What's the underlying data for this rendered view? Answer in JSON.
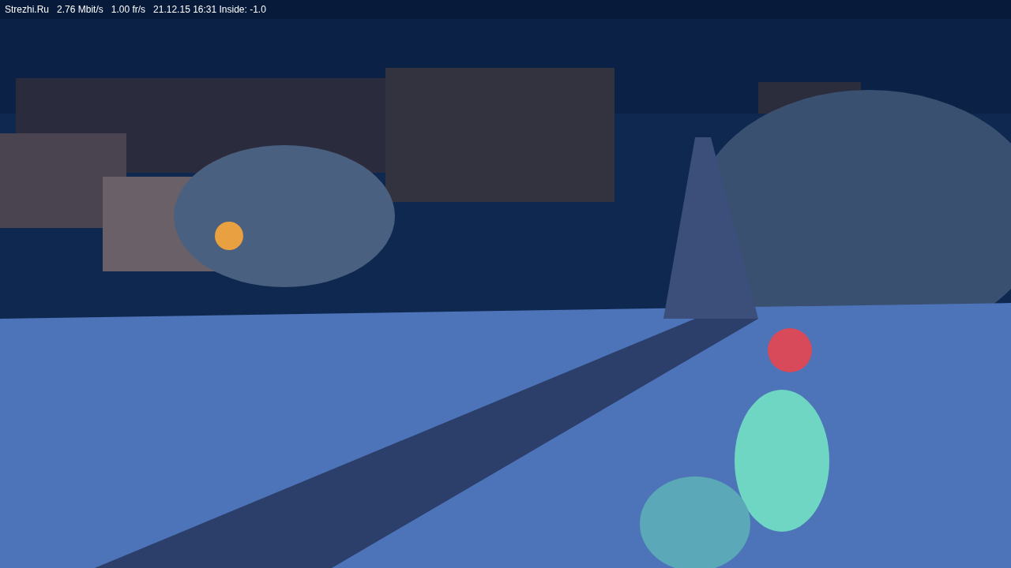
{
  "overlay": {
    "items": [
      {
        "text": "Strezhi.Ru"
      },
      {
        "text": "2.76 Mbit/s"
      },
      {
        "text": "1.00 fr/s"
      },
      {
        "text": "21.12.15 16:31 Inside: -1.0"
      }
    ]
  }
}
